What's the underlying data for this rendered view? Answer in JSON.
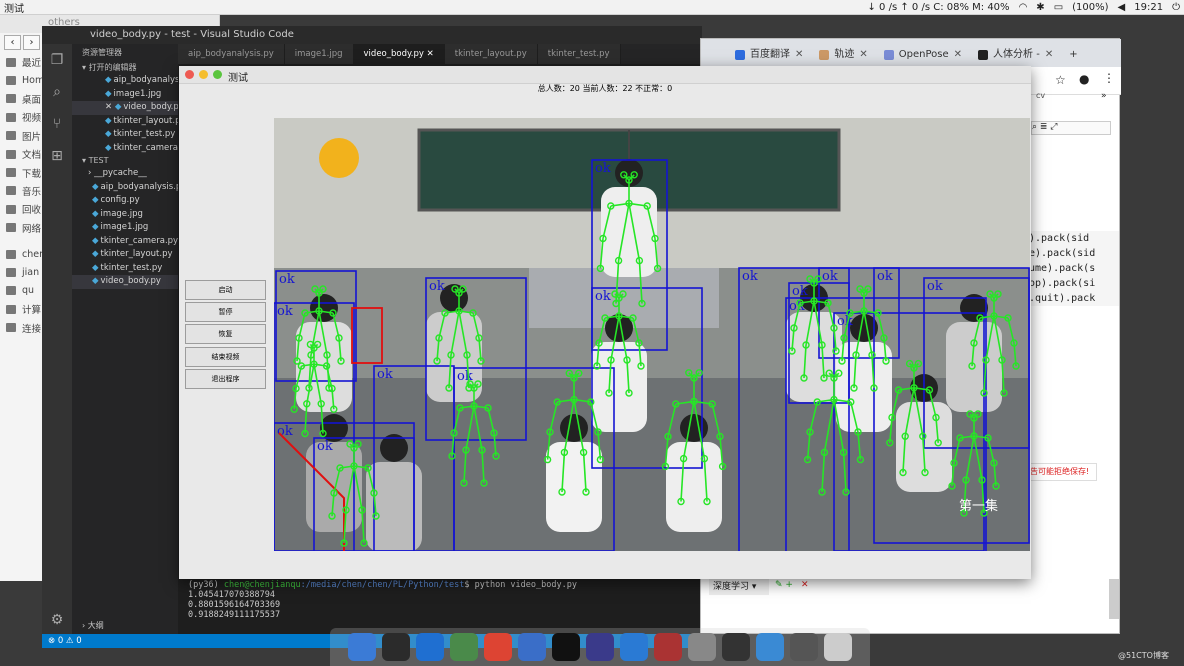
{
  "topbar": {
    "title": "测试",
    "status": "↓ 0 /s ↑ 0 /s C: 08% M: 40%",
    "battery": "(100%)",
    "time": "19:21",
    "icons": {
      "wifi": "wifi-icon",
      "bluetooth": "bluetooth-icon",
      "volume": "volume-icon",
      "power": "power-icon"
    }
  },
  "files": {
    "title": "others",
    "items": [
      {
        "label": "最近",
        "icon": "clock-icon"
      },
      {
        "label": "Hom",
        "icon": "home-icon"
      },
      {
        "label": "桌面",
        "icon": "desktop-icon"
      },
      {
        "label": "视频",
        "icon": "video-icon"
      },
      {
        "label": "图片",
        "icon": "image-icon"
      },
      {
        "label": "文档",
        "icon": "document-icon"
      },
      {
        "label": "下载",
        "icon": "download-icon"
      },
      {
        "label": "音乐",
        "icon": "music-icon"
      },
      {
        "label": "回收",
        "icon": "trash-icon"
      },
      {
        "label": "网络",
        "icon": "network-icon"
      },
      {
        "label": "chen",
        "icon": "drive-icon"
      },
      {
        "label": "jian",
        "icon": "drive-icon"
      },
      {
        "label": "qu",
        "icon": "drive-icon"
      },
      {
        "label": "计算",
        "icon": "computer-icon"
      },
      {
        "label": "连接",
        "icon": "server-icon"
      }
    ]
  },
  "vscode": {
    "title": "video_body.py - test - Visual Studio Code",
    "sidebar_title": "资源管理器",
    "open_editors_label": "打开的编辑器",
    "open_editors": [
      "aip_bodyanalysis...",
      "image1.jpg",
      "video_body.py",
      "tkinter_layout.py",
      "tkinter_test.py",
      "tkinter_camera.py"
    ],
    "project_label": "TEST",
    "project_files": [
      "__pycache__",
      "aip_bodyanalysis.py",
      "config.py",
      "image.jpg",
      "image1.jpg",
      "tkinter_camera.py",
      "tkinter_layout.py",
      "tkinter_test.py",
      "video_body.py"
    ],
    "tabs": [
      "aip_bodyanalysis.py",
      "image1.jpg",
      "video_body.py",
      "tkinter_layout.py",
      "tkinter_test.py"
    ],
    "terminal": {
      "prompt_env": "(py36)",
      "prompt_user": "chen@chenjianqu",
      "prompt_path": ":/media/chen/chen/PL/Python/test",
      "command": "$ python video_body.py",
      "lines": [
        "1.045417070388794",
        "0.8801596164703369",
        "0.9188249111175537"
      ]
    },
    "outline_label": "大纲",
    "status": "⊗ 0 ⚠ 0"
  },
  "chrome": {
    "tabs": [
      {
        "label": "百度翻译",
        "color": "#2d6cdf"
      },
      {
        "label": "轨迹",
        "color": "#c96"
      },
      {
        "label": "OpenPose",
        "color": "#7a8cd6"
      },
      {
        "label": "人体分析 -",
        "color": "#222"
      }
    ],
    "bookmark": "cv",
    "code_lines": [
      ").pack(sid",
      "e).pack(sid",
      "ume).pack(s",
      "op).pack(si",
      ".quit).pack"
    ],
    "warning": "告可能拒绝保存!",
    "dropdown": "深度学习"
  },
  "tk": {
    "title": "测试",
    "stats": "总人数：20 当前人数：22 不正常：0",
    "buttons": [
      "启动",
      "暂停",
      "恢复",
      "结束视频",
      "退出程序"
    ],
    "video_caption": "第一集",
    "detection_label": "ok"
  },
  "dock": {
    "apps": [
      {
        "name": "finder-icon",
        "color": "#3b7bd6"
      },
      {
        "name": "terminal-icon",
        "color": "#2b2b2b"
      },
      {
        "name": "wps-icon",
        "color": "#1f6fd1"
      },
      {
        "name": "nqq-icon",
        "color": "#4a8a4a"
      },
      {
        "name": "chrome-icon",
        "color": "#dd4433"
      },
      {
        "name": "settings-icon",
        "color": "#3a6ec8"
      },
      {
        "name": "qq-icon",
        "color": "#111"
      },
      {
        "name": "utf-editor-icon",
        "color": "#3a3a8a"
      },
      {
        "name": "vscode-icon",
        "color": "#2a7ad4"
      },
      {
        "name": "photo-icon",
        "color": "#a33"
      },
      {
        "name": "draw-icon",
        "color": "#888"
      },
      {
        "name": "lock-icon",
        "color": "#333"
      },
      {
        "name": "window-icon",
        "color": "#3a8ad4"
      },
      {
        "name": "tools-icon",
        "color": "#555"
      },
      {
        "name": "apps-icon",
        "color": "#ccc"
      }
    ]
  },
  "watermark": "@51CTO博客"
}
